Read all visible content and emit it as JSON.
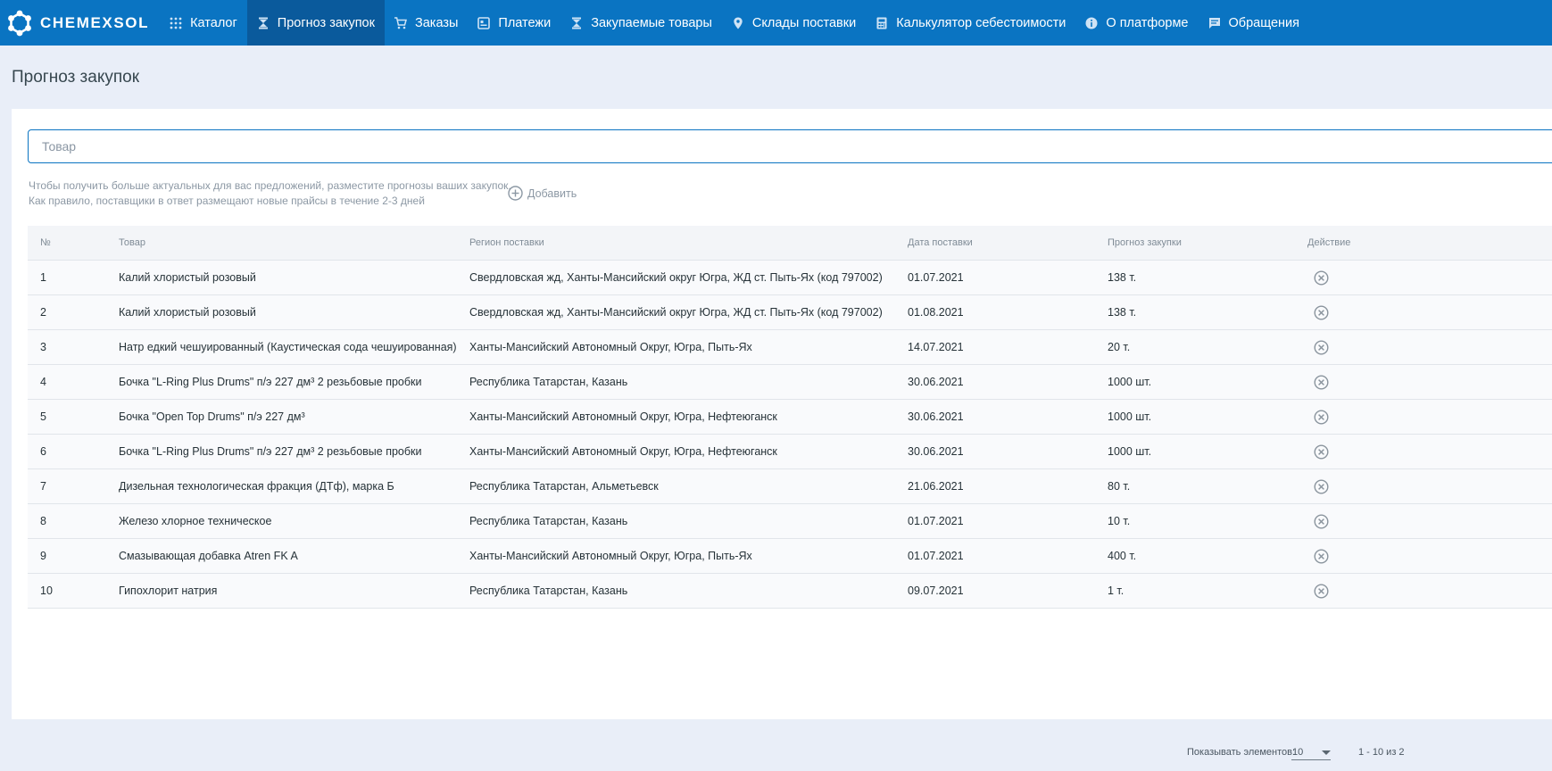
{
  "brand": {
    "name": "CHEMEXSOL"
  },
  "nav": [
    {
      "label": "Каталог",
      "icon": "grid-icon",
      "active": false
    },
    {
      "label": "Прогноз закупок",
      "icon": "hourglass-icon",
      "active": true
    },
    {
      "label": "Заказы",
      "icon": "cart-icon",
      "active": false
    },
    {
      "label": "Платежи",
      "icon": "payment-icon",
      "active": false
    },
    {
      "label": "Закупаемые товары",
      "icon": "hourglass-icon",
      "active": false
    },
    {
      "label": "Склады поставки",
      "icon": "location-pin-icon",
      "active": false
    },
    {
      "label": "Калькулятор себестоимости",
      "icon": "calculator-icon",
      "active": false
    },
    {
      "label": "О платформе",
      "icon": "info-icon",
      "active": false
    },
    {
      "label": "Обращения",
      "icon": "message-icon",
      "active": false
    }
  ],
  "page": {
    "title": "Прогноз закупок"
  },
  "search": {
    "placeholder": "Товар"
  },
  "hint": {
    "line1": "Чтобы получить больше актуальных для вас предложений, разместите прогнозы ваших закупок.",
    "line2": "Как правило, поставщики в ответ размещают новые прайсы в течение 2-3 дней",
    "add_label": "Добавить"
  },
  "table": {
    "headers": {
      "num": "№",
      "product": "Товар",
      "region": "Регион поставки",
      "date": "Дата поставки",
      "forecast": "Прогноз закупки",
      "action": "Действие"
    },
    "rows": [
      {
        "num": "1",
        "product": "Калий хлористый розовый",
        "region": "Свердловская жд, Ханты-Мансийский округ Югра, ЖД ст. Пыть-Ях (код 797002)",
        "date": "01.07.2021",
        "forecast": "138 т."
      },
      {
        "num": "2",
        "product": "Калий хлористый розовый",
        "region": "Свердловская жд, Ханты-Мансийский округ Югра, ЖД ст. Пыть-Ях (код 797002)",
        "date": "01.08.2021",
        "forecast": "138 т."
      },
      {
        "num": "3",
        "product": "Натр едкий чешуированный (Каустическая сода чешуированная)",
        "region": "Ханты-Мансийский Автономный Округ, Югра, Пыть-Ях",
        "date": "14.07.2021",
        "forecast": "20 т."
      },
      {
        "num": "4",
        "product": "Бочка \"L-Ring Plus Drums\" п/э 227 дм³ 2 резьбовые пробки",
        "region": "Республика Татарстан, Казань",
        "date": "30.06.2021",
        "forecast": "1000 шт."
      },
      {
        "num": "5",
        "product": "Бочка \"Open Top Drums\" п/э 227 дм³",
        "region": "Ханты-Мансийский Автономный Округ, Югра, Нефтеюганск",
        "date": "30.06.2021",
        "forecast": "1000 шт."
      },
      {
        "num": "6",
        "product": "Бочка \"L-Ring Plus Drums\" п/э 227 дм³ 2 резьбовые пробки",
        "region": "Ханты-Мансийский Автономный Округ, Югра, Нефтеюганск",
        "date": "30.06.2021",
        "forecast": "1000 шт."
      },
      {
        "num": "7",
        "product": "Дизельная технологическая фракция (ДТф), марка Б",
        "region": "Республика Татарстан, Альметьевск",
        "date": "21.06.2021",
        "forecast": "80 т."
      },
      {
        "num": "8",
        "product": "Железо хлорное техническое",
        "region": "Республика Татарстан, Казань",
        "date": "01.07.2021",
        "forecast": "10 т."
      },
      {
        "num": "9",
        "product": "Смазывающая добавка Atren FK A",
        "region": "Ханты-Мансийский Автономный Округ, Югра, Пыть-Ях",
        "date": "01.07.2021",
        "forecast": "400 т."
      },
      {
        "num": "10",
        "product": "Гипохлорит натрия",
        "region": "Республика Татарстан, Казань",
        "date": "09.07.2021",
        "forecast": "1 т."
      }
    ]
  },
  "pager": {
    "label": "Показывать элементов:",
    "page_size": "10",
    "range": "1 - 10 из 2"
  },
  "colors": {
    "nav_bg": "#0a74c2",
    "nav_active": "#0a5a9c",
    "page_bg": "#e9eef8"
  }
}
